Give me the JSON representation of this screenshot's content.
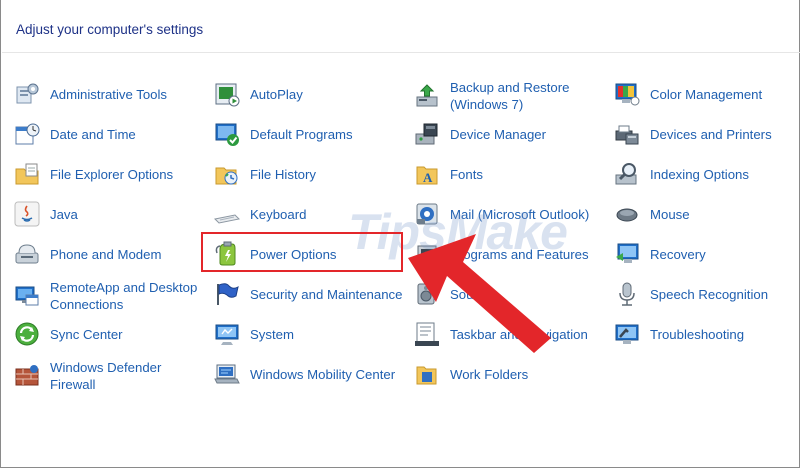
{
  "header": {
    "title": "Adjust your computer's settings"
  },
  "watermark": {
    "text": "TipsMake"
  },
  "items": [
    {
      "id": "administrative-tools",
      "label": "Administrative Tools",
      "icon": "admin-tools-icon"
    },
    {
      "id": "autoplay",
      "label": "AutoPlay",
      "icon": "autoplay-icon"
    },
    {
      "id": "backup-and-restore",
      "label": "Backup and Restore (Windows 7)",
      "icon": "backup-restore-icon"
    },
    {
      "id": "color-management",
      "label": "Color Management",
      "icon": "color-management-icon"
    },
    {
      "id": "date-and-time",
      "label": "Date and Time",
      "icon": "date-time-icon"
    },
    {
      "id": "default-programs",
      "label": "Default Programs",
      "icon": "default-programs-icon"
    },
    {
      "id": "device-manager",
      "label": "Device Manager",
      "icon": "device-manager-icon"
    },
    {
      "id": "devices-and-printers",
      "label": "Devices and Printers",
      "icon": "printer-icon"
    },
    {
      "id": "file-explorer-options",
      "label": "File Explorer Options",
      "icon": "folder-options-icon"
    },
    {
      "id": "file-history",
      "label": "File History",
      "icon": "file-history-icon"
    },
    {
      "id": "fonts",
      "label": "Fonts",
      "icon": "fonts-icon"
    },
    {
      "id": "indexing-options",
      "label": "Indexing Options",
      "icon": "indexing-icon"
    },
    {
      "id": "java",
      "label": "Java",
      "icon": "java-icon"
    },
    {
      "id": "keyboard",
      "label": "Keyboard",
      "icon": "keyboard-icon"
    },
    {
      "id": "mail",
      "label": "Mail (Microsoft Outlook)",
      "icon": "mail-icon"
    },
    {
      "id": "mouse",
      "label": "Mouse",
      "icon": "mouse-icon"
    },
    {
      "id": "phone-and-modem",
      "label": "Phone and Modem",
      "icon": "phone-modem-icon"
    },
    {
      "id": "power-options",
      "label": "Power Options",
      "icon": "power-options-icon"
    },
    {
      "id": "programs-and-features",
      "label": "Programs and Features",
      "icon": "programs-features-icon"
    },
    {
      "id": "recovery",
      "label": "Recovery",
      "icon": "recovery-icon"
    },
    {
      "id": "remoteapp",
      "label": "RemoteApp and Desktop Connections",
      "icon": "remoteapp-icon"
    },
    {
      "id": "security-and-maintenance",
      "label": "Security and Maintenance",
      "icon": "security-flag-icon"
    },
    {
      "id": "sound",
      "label": "Sound",
      "icon": "sound-icon"
    },
    {
      "id": "speech-recognition",
      "label": "Speech Recognition",
      "icon": "microphone-icon"
    },
    {
      "id": "sync-center",
      "label": "Sync Center",
      "icon": "sync-icon"
    },
    {
      "id": "system",
      "label": "System",
      "icon": "system-icon"
    },
    {
      "id": "taskbar-and-navigation",
      "label": "Taskbar and Navigation",
      "icon": "taskbar-icon"
    },
    {
      "id": "troubleshooting",
      "label": "Troubleshooting",
      "icon": "troubleshooting-icon"
    },
    {
      "id": "windows-defender-firewall",
      "label": "Windows Defender Firewall",
      "icon": "firewall-icon"
    },
    {
      "id": "windows-mobility-center",
      "label": "Windows Mobility Center",
      "icon": "mobility-icon"
    },
    {
      "id": "work-folders",
      "label": "Work Folders",
      "icon": "work-folders-icon"
    }
  ],
  "colors": {
    "link": "#1f5fb0",
    "title": "#1e3287",
    "highlight": "#e3262a",
    "arrow": "#e3262a"
  }
}
